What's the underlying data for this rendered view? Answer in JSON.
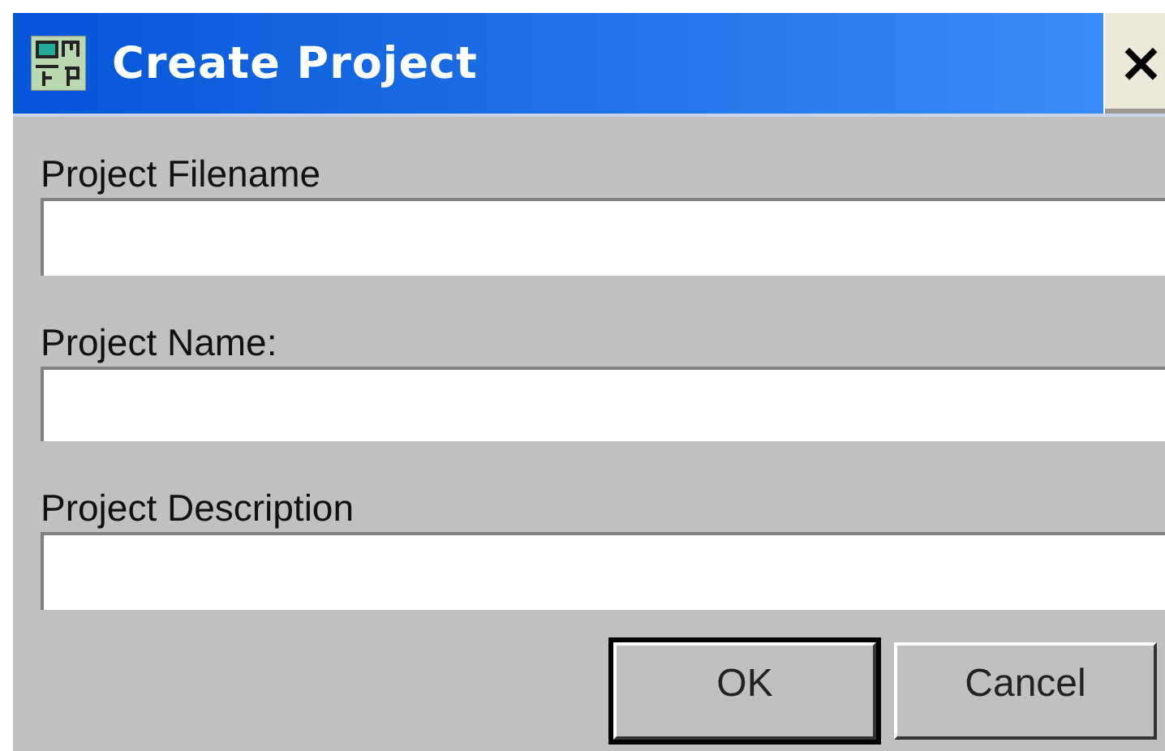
{
  "window": {
    "title": "Create Project",
    "close_label": "×"
  },
  "fields": [
    {
      "label": "Project Filename"
    },
    {
      "label": "Project Name:"
    },
    {
      "label": "Project Description"
    }
  ],
  "buttons": [
    {
      "label": "OK",
      "default": true
    },
    {
      "label": "Cancel",
      "default": false
    }
  ]
}
